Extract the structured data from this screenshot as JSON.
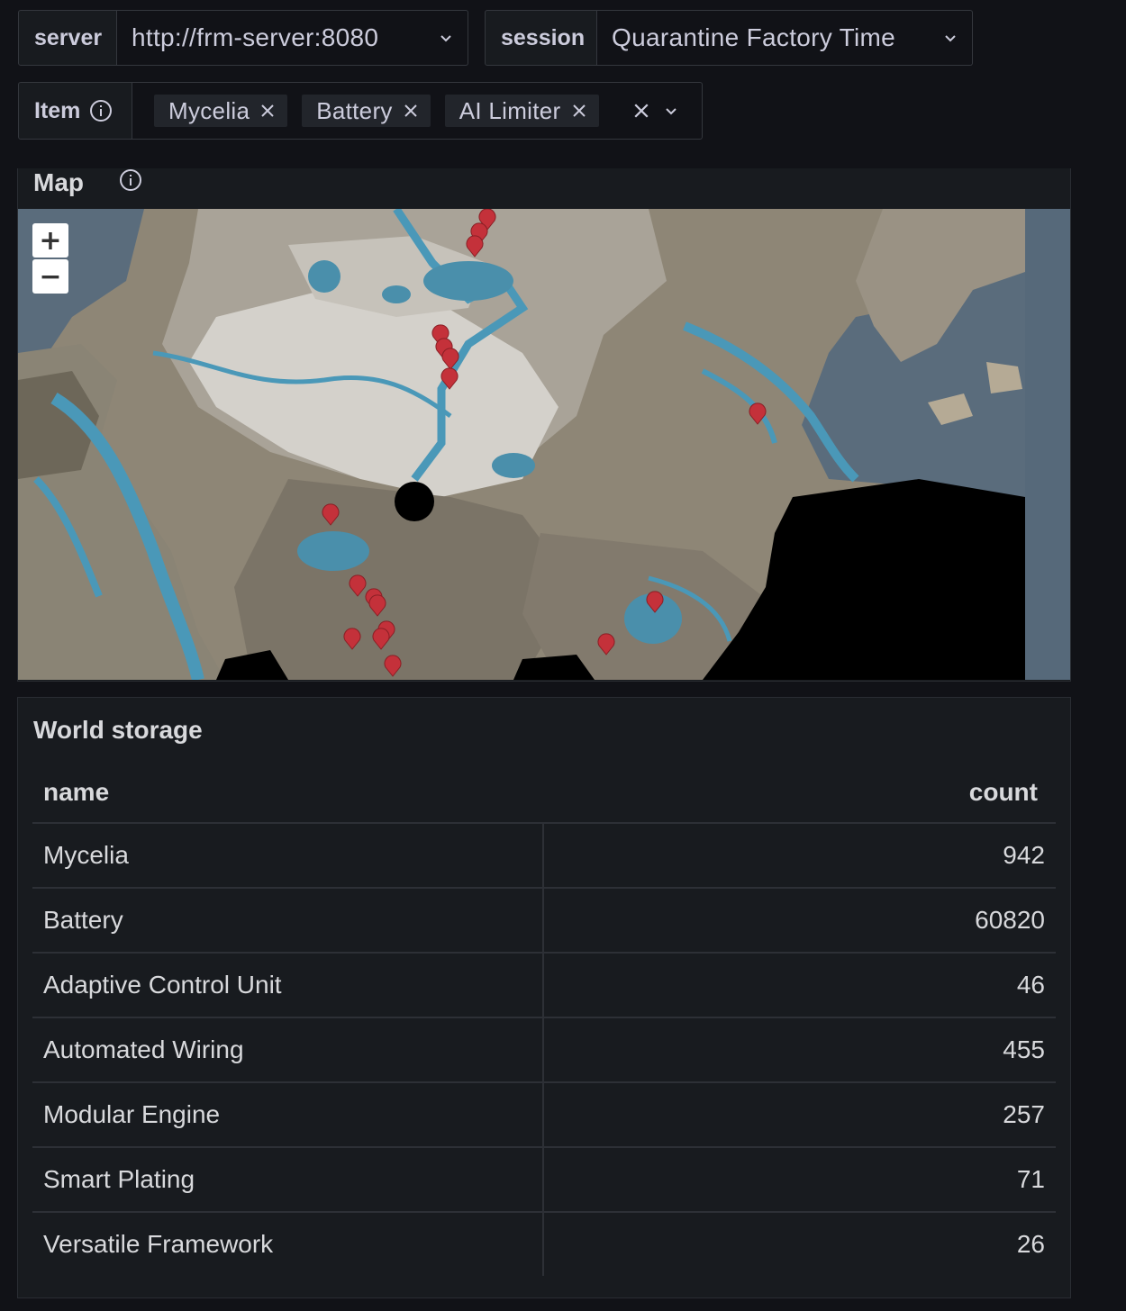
{
  "variables": {
    "server": {
      "label": "server",
      "value": "http://frm-server:8080"
    },
    "session": {
      "label": "session",
      "value": "Quarantine Factory Time"
    },
    "item": {
      "label": "Item",
      "chips": [
        "Mycelia",
        "Battery",
        "AI Limiter"
      ]
    }
  },
  "map_panel": {
    "title": "Map",
    "zoom_in": "+",
    "zoom_out": "−",
    "marker_color": "#c4313a"
  },
  "storage_panel": {
    "title": "World storage",
    "columns": [
      "name",
      "count"
    ],
    "rows": [
      {
        "name": "Mycelia",
        "count": "942"
      },
      {
        "name": "Battery",
        "count": "60820"
      },
      {
        "name": "Adaptive Control Unit",
        "count": "46"
      },
      {
        "name": "Automated Wiring",
        "count": "455"
      },
      {
        "name": "Modular Engine",
        "count": "257"
      },
      {
        "name": "Smart Plating",
        "count": "71"
      },
      {
        "name": "Versatile Framework",
        "count": "26"
      }
    ]
  }
}
